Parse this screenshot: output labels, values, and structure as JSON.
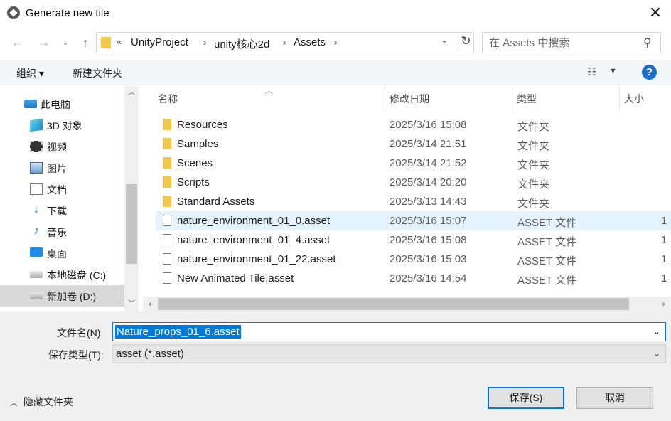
{
  "window": {
    "title": "Generate new tile",
    "close_glyph": "✕"
  },
  "address": {
    "overflow": "«",
    "crumbs": [
      "UnityProject",
      "unity核心2d",
      "Assets"
    ],
    "separator": "›"
  },
  "search": {
    "placeholder": "在 Assets 中搜索"
  },
  "toolbar": {
    "organize": "组织 ▾",
    "new_folder": "新建文件夹",
    "help": "?"
  },
  "nav": {
    "items": [
      {
        "label": "此电脑",
        "icon": "pc-icon"
      },
      {
        "label": "3D 对象",
        "icon": "3d-objects-icon"
      },
      {
        "label": "视频",
        "icon": "video-icon"
      },
      {
        "label": "图片",
        "icon": "pictures-icon"
      },
      {
        "label": "文档",
        "icon": "documents-icon"
      },
      {
        "label": "下载",
        "icon": "download-icon"
      },
      {
        "label": "音乐",
        "icon": "music-icon"
      },
      {
        "label": "桌面",
        "icon": "desktop-icon"
      },
      {
        "label": "本地磁盘 (C:)",
        "icon": "drive-icon"
      },
      {
        "label": "新加卷 (D:)",
        "icon": "drive-icon",
        "selected": true
      }
    ]
  },
  "columns": {
    "name": "名称",
    "date": "修改日期",
    "type": "类型",
    "size": "大小"
  },
  "files": [
    {
      "name": "Resources",
      "date": "2025/3/16 15:08",
      "type": "文件夹",
      "size": "",
      "kind": "folder"
    },
    {
      "name": "Samples",
      "date": "2025/3/14 21:51",
      "type": "文件夹",
      "size": "",
      "kind": "folder"
    },
    {
      "name": "Scenes",
      "date": "2025/3/14 21:52",
      "type": "文件夹",
      "size": "",
      "kind": "folder"
    },
    {
      "name": "Scripts",
      "date": "2025/3/14 20:20",
      "type": "文件夹",
      "size": "",
      "kind": "folder"
    },
    {
      "name": "Standard Assets",
      "date": "2025/3/13 14:43",
      "type": "文件夹",
      "size": "",
      "kind": "folder"
    },
    {
      "name": "nature_environment_01_0.asset",
      "date": "2025/3/16 15:07",
      "type": "ASSET 文件",
      "size": "1",
      "kind": "file",
      "highlight": true
    },
    {
      "name": "nature_environment_01_4.asset",
      "date": "2025/3/16 15:08",
      "type": "ASSET 文件",
      "size": "1",
      "kind": "file"
    },
    {
      "name": "nature_environment_01_22.asset",
      "date": "2025/3/16 15:03",
      "type": "ASSET 文件",
      "size": "1",
      "kind": "file"
    },
    {
      "name": "New Animated Tile.asset",
      "date": "2025/3/16 14:54",
      "type": "ASSET 文件",
      "size": "1",
      "kind": "file"
    }
  ],
  "form": {
    "filename_label": "文件名(N):",
    "filename_value": "Nature_props_01_6.asset",
    "savetype_label": "保存类型(T):",
    "savetype_value": "asset (*.asset)"
  },
  "footer": {
    "hide_folders": "隐藏文件夹",
    "save": "保存(S)",
    "cancel": "取消"
  }
}
